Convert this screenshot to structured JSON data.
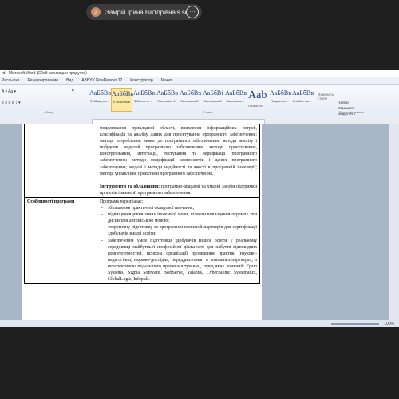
{
  "share": {
    "avatar_letter": "З",
    "title": "Замрій Ірина Вікторівна's screen",
    "more": "⋯"
  },
  "word": {
    "titlebar": "rd - Microsoft Word (Сбой активации продукта)",
    "tabs": [
      "Рассылка",
      "Рецензирование",
      "Вид",
      "ABBYY FineReader 12",
      "Конструктор",
      "Макет"
    ],
    "styles": [
      {
        "sample": "АаБбВв",
        "name": "¶ Обычный",
        "selected": true
      },
      {
        "sample": "АаБбВв",
        "name": "¶ Без инте..."
      },
      {
        "sample": "АаБбВв",
        "name": "Заголовок 1"
      },
      {
        "sample": "АаБбВв",
        "name": "Заголовок 2"
      },
      {
        "sample": "АаБбВі",
        "name": "Заголовок 3"
      },
      {
        "sample": "АаБбВв",
        "name": "Заголовок 4"
      }
    ],
    "aab_sample": "Aab",
    "aab_name": "Название",
    "more_styles": [
      {
        "sample": "АаБбВв",
        "name": "Подзаголо..."
      },
      {
        "sample": "АаБбВв",
        "name": "Слабое вы..."
      }
    ],
    "change_styles": "Изменить стили",
    "group_font": "Абзац",
    "group_styles": "Стили",
    "group_edit": "Редактирование",
    "find": "Найти",
    "replace": "Заменить",
    "select": "Выделить",
    "other_style": "Выделени...",
    "left_style": "¶ Абзац сп...",
    "status_zoom": "100%"
  },
  "document": {
    "row1_left": "",
    "row1_p1": "моделювання прикладної області, виявлення інформаційних потреб, класифікація та аналізу даних для проєктування програмного забезпечення; методи розроблення вимог до програмного забезпечення; методи аналізу і побудови моделей програмного забезпечення; методи проєктування, конструювання, інтеграції, тестування та верифікації програмного забезпечення; методи модифікації компонентів і даних програмного забезпечення; моделі і методи надійності та якості в програмній інженерії; методи управління проєктами програмного забезпечення.",
    "row1_p2_label": "Інструменти та обладнання:",
    "row1_p2": " програмно-апаратні та хмарні засоби підтримки процесів інженерії програмного забезпечення.",
    "row2_left": "Особливості програми",
    "row2_intro": "Програма передбачає:",
    "row2_items": [
      "збільшення практичної складової навчання;",
      "підвищення рівня знань іноземної мови, шляхом викладання окремих тем дисциплін англійською мовою;",
      "теоретичну підготовку за програмами компаній-партнерів для сертифікації здобувачів вищої освіти;",
      "забезпечення умов підготовки здобувачів вищої освіти у реальному середовищі майбутньої професійної діяльності для набуття відповідних компетентностей, шляхом організації проведення практик (науково-педагогічна, науково-дослідна, переддипломна) в компаніях-партнерах, з перспективою подальшого працевлаштування, серед яких компанії: Epam Systems, Sigma Software, SoftServe, Yalantis, CyberBionic Systematics, GlobalLogic, Infopuls."
    ]
  }
}
